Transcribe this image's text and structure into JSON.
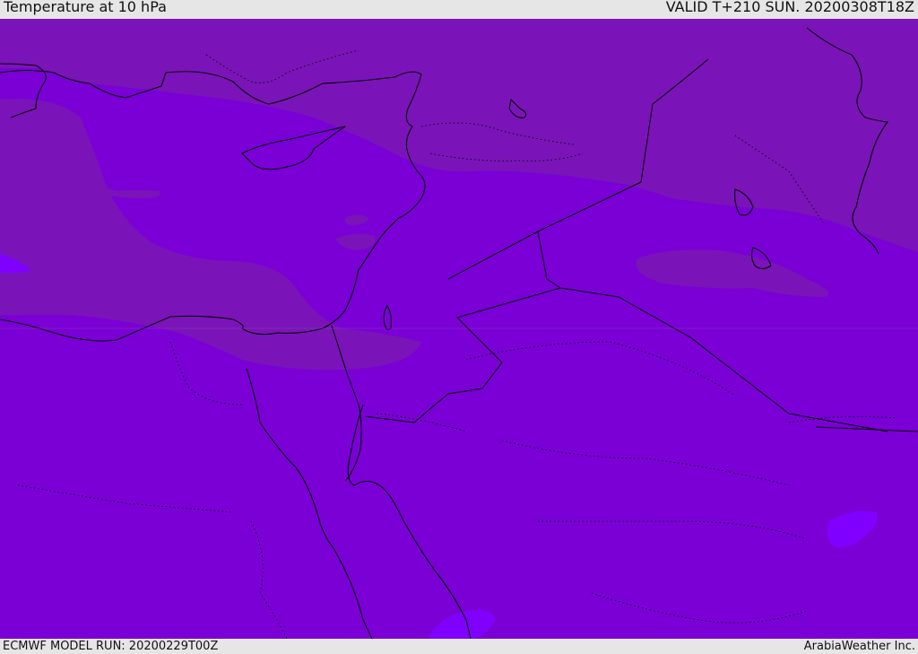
{
  "header": {
    "title": "Temperature at 10 hPa",
    "valid": "VALID T+210 SUN. 20200308T18Z"
  },
  "footer": {
    "model_run": "ECMWF MODEL RUN: 20200229T00Z",
    "credit": "ArabiaWeather Inc."
  },
  "colors": {
    "field_base": "#7a00d6",
    "field_dark": "#7a14b8",
    "field_light": "#8000ff",
    "coastline": "#000000",
    "frame": "#e6e6e6"
  }
}
